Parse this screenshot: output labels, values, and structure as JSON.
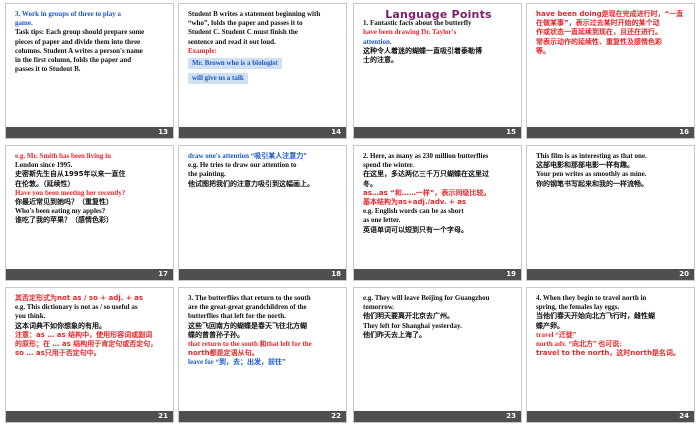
{
  "slides": [
    {
      "num": "13",
      "lines": [
        {
          "t": "3. Work in groups of three to play a",
          "c": "blue bold"
        },
        {
          "t": "game.",
          "c": "blue bold"
        },
        {
          "t": "Task tips: Each group should prepare some",
          "c": "bold"
        },
        {
          "t": "pieces of paper and divide them into three",
          "c": "bold"
        },
        {
          "t": "columns. Student A writes a person's name",
          "c": "bold"
        },
        {
          "t": "in the first column, folds the paper and",
          "c": "bold"
        },
        {
          "t": "passes it to Student B.",
          "c": "bold"
        }
      ]
    },
    {
      "num": "14",
      "lines": [
        {
          "t": "Student B writes a statement beginning with",
          "c": "bold"
        },
        {
          "t": "“who”, folds the paper and passes it to",
          "c": "bold"
        },
        {
          "t": "Student C. Student C must finish the",
          "c": "bold"
        },
        {
          "t": "sentence and read it out loud.",
          "c": "bold"
        },
        {
          "t": "Example:",
          "c": "red bold"
        },
        {
          "t": "Mr. Brown      who is a biologist",
          "c": "chip"
        },
        {
          "t": "will give us a talk",
          "c": "chip"
        }
      ]
    },
    {
      "num": "15",
      "title": "Language Points",
      "lines": [
        {
          "t": "1. Fantastic facts about the butterfly",
          "c": "bold"
        },
        {
          "t": "have been drawing Dr. Taylor's",
          "c": "red bold"
        },
        {
          "t": "attention.",
          "c": "blue bold"
        },
        {
          "t": "这种令人着迷的蝴蝶一直吸引着泰勒博",
          "c": "zh"
        },
        {
          "t": "士的注意。",
          "c": "zh"
        }
      ]
    },
    {
      "num": "16",
      "lines": [
        {
          "t": "have been doing是现在完成进行时，“一直",
          "c": "zhred"
        },
        {
          "t": "在做某事”，表示过去某时开始的某个动",
          "c": "zhred"
        },
        {
          "t": "作或状态一直延续到现在，且还在进行。",
          "c": "zhred"
        },
        {
          "t": "常表示动作的延续性、重复性及感情色彩",
          "c": "zhred"
        },
        {
          "t": "等。",
          "c": "zhred"
        }
      ]
    },
    {
      "num": "17",
      "lines": [
        {
          "t": "e.g. Mr. Smith has been living in",
          "c": "red bold"
        },
        {
          "t": "London since 1995.",
          "c": "bold"
        },
        {
          "t": "史密斯先生自从1995年以来一直住",
          "c": "zh"
        },
        {
          "t": "在伦敦。（延续性）",
          "c": "zh"
        },
        {
          "t": "Have you been meeting her recently?",
          "c": "red bold"
        },
        {
          "t": "你最近常见到她吗？（重复性）",
          "c": "zh"
        },
        {
          "t": "Who's been eating my apples?",
          "c": "bold"
        },
        {
          "t": "谁吃了我的苹果？（感情色彩）",
          "c": "zh"
        }
      ]
    },
    {
      "num": "18",
      "lines": [
        {
          "t": "draw one's attention “吸引某人注意力”",
          "c": "blue bold"
        },
        {
          "t": "e.g. He tries to draw our attention to",
          "c": "bold"
        },
        {
          "t": "the painting.",
          "c": "bold"
        },
        {
          "t": "他试图把我们的注意力吸引到这幅画上。",
          "c": "zh"
        }
      ]
    },
    {
      "num": "19",
      "lines": [
        {
          "t": "2. Here, as many as 230 million butterflies",
          "c": "bold"
        },
        {
          "t": "spend the winter.",
          "c": "bold"
        },
        {
          "t": "在这里，多达两亿三千万只蝴蝶在这里过",
          "c": "zh"
        },
        {
          "t": "冬。",
          "c": "zh"
        },
        {
          "t": "as…as “和……一样”，表示同级比较。",
          "c": "zhred"
        },
        {
          "t": "基本结构为as+adj./adv. + as",
          "c": "zhred"
        },
        {
          "t": "e.g. English words can be as short",
          "c": "bold"
        },
        {
          "t": "as one letter.",
          "c": "bold"
        },
        {
          "t": "英语单词可以短到只有一个字母。",
          "c": "zh"
        }
      ]
    },
    {
      "num": "20",
      "lines": [
        {
          "t": "This film is as interesting as that one.",
          "c": "bold"
        },
        {
          "t": "这部电影和那部电影一样有趣。",
          "c": "zh"
        },
        {
          "t": "Your pen writes as smoothly as mine.",
          "c": "bold"
        },
        {
          "t": "你的钢笔书写起来和我的一样流畅。",
          "c": "zh"
        }
      ]
    },
    {
      "num": "21",
      "lines": [
        {
          "t": "其否定形式为not as / so + adj. + as",
          "c": "zhred"
        },
        {
          "t": "e.g. This dictionary is not as / so useful as",
          "c": "bold"
        },
        {
          "t": "you think.",
          "c": "bold"
        },
        {
          "t": "这本词典不如你想象的有用。",
          "c": "zh"
        },
        {
          "t": "注意：as … as 结构中，使用形容词或副词",
          "c": "zhred"
        },
        {
          "t": "的原形；在 … as 结构用于肯定句或否定句，",
          "c": "zhred"
        },
        {
          "t": "so … as只用于否定句中。",
          "c": "zhred"
        }
      ]
    },
    {
      "num": "22",
      "lines": [
        {
          "t": "3. The butterflies that return to the south",
          "c": "bold"
        },
        {
          "t": "are the great-great grandchildren of the",
          "c": "bold"
        },
        {
          "t": "butterflies that left for the north.",
          "c": "bold"
        },
        {
          "t": "这些飞回南方的蝴蝶是春天飞往北方蝴",
          "c": "zh"
        },
        {
          "t": "蝶的曾曾孙子孙。",
          "c": "zh"
        },
        {
          "t": "that return to the south 和that left for the",
          "c": "red bold"
        },
        {
          "t": "north都是定语从句。",
          "c": "zhred"
        },
        {
          "t": "leave for “到，去；出发，前往”",
          "c": "blue bold"
        }
      ]
    },
    {
      "num": "23",
      "lines": [
        {
          "t": "e.g. They will leave Beijing for Guangzhou",
          "c": "bold"
        },
        {
          "t": "tomorrow.",
          "c": "bold"
        },
        {
          "t": "他们明天要离开北京去广州。",
          "c": "zh"
        },
        {
          "t": "They left for Shanghai yesterday.",
          "c": "bold"
        },
        {
          "t": "他们昨天去上海了。",
          "c": "zh"
        }
      ]
    },
    {
      "num": "24",
      "lines": [
        {
          "t": "4. When they begin to travel north in",
          "c": "bold"
        },
        {
          "t": "spring, the females lay eggs.",
          "c": "bold"
        },
        {
          "t": "当他们春天开始向北方飞行时，雌性蝴",
          "c": "zh"
        },
        {
          "t": "蝶产卵。",
          "c": "zh"
        },
        {
          "t": "travel “迁徙”",
          "c": "red bold"
        },
        {
          "t": "north adv. “向北方” 也可说:",
          "c": "red bold"
        },
        {
          "t": "travel to the north，这时north是名词。",
          "c": "zhred"
        }
      ]
    }
  ]
}
